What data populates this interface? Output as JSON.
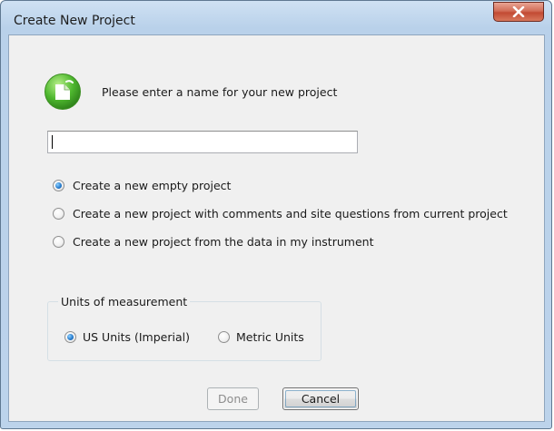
{
  "window": {
    "title": "Create New Project",
    "close_icon": "close-x-icon",
    "app_icon": "new-project-icon"
  },
  "prompt": "Please enter a name for your new project",
  "name_input": {
    "value": "",
    "placeholder": ""
  },
  "options": [
    {
      "label": "Create a new empty project",
      "checked": true
    },
    {
      "label": "Create a new project with comments and site questions from current project",
      "checked": false
    },
    {
      "label": "Create a new project from the data in my instrument",
      "checked": false
    }
  ],
  "units": {
    "legend": "Units of measurement",
    "options": [
      {
        "label": "US Units (Imperial)",
        "checked": true
      },
      {
        "label": "Metric Units",
        "checked": false
      }
    ]
  },
  "buttons": {
    "done": {
      "label": "Done",
      "enabled": false
    },
    "cancel": {
      "label": "Cancel",
      "enabled": true
    }
  }
}
